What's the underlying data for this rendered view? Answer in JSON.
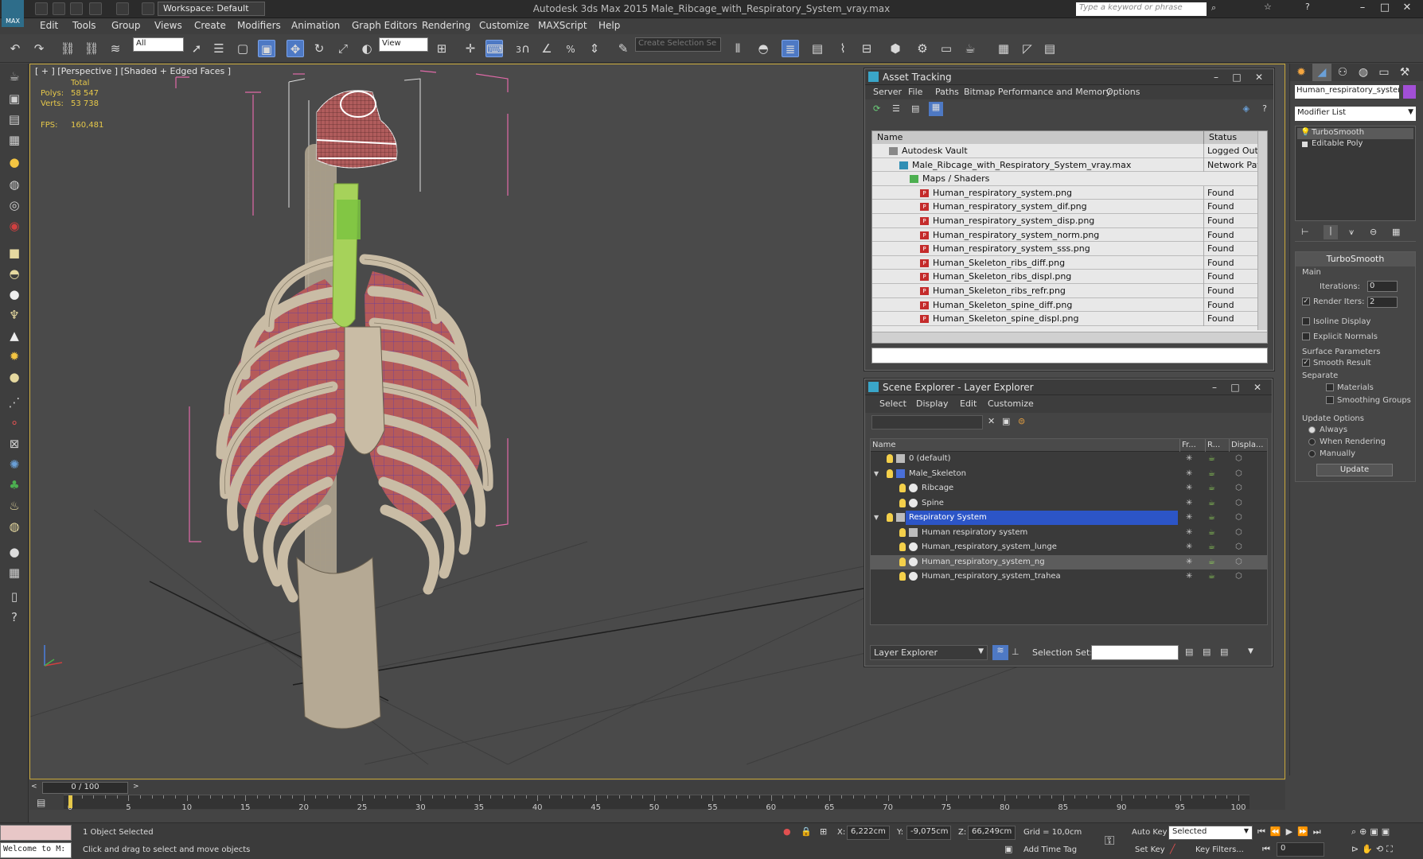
{
  "title_bar": {
    "app_title": "Autodesk 3ds Max 2015    Male_Ribcage_with_Respiratory_System_vray.max",
    "workspace": "Workspace: Default",
    "search_placeholder": "Type a keyword or phrase",
    "app_button": "MAX"
  },
  "menu": [
    "Edit",
    "Tools",
    "Group",
    "Views",
    "Create",
    "Modifiers",
    "Animation",
    "Graph Editors",
    "Rendering",
    "Customize",
    "MAXScript",
    "Help"
  ],
  "toolbar": {
    "selection_filter": "All",
    "ref_coord": "View",
    "named_selection_placeholder": "Create Selection Se",
    "snap_labels": [
      "3",
      "%"
    ]
  },
  "viewport": {
    "label": "[ + ] [Perspective ] [Shaded + Edged Faces ]",
    "stats_header": "Total",
    "polys_label": "Polys:",
    "polys_value": "58 547",
    "verts_label": "Verts:",
    "verts_value": "53 738",
    "fps_label": "FPS:",
    "fps_value": "160,481"
  },
  "asset_tracking": {
    "title": "Asset Tracking",
    "menu": [
      "Server",
      "File",
      "Paths",
      "Bitmap Performance and Memory",
      "Options"
    ],
    "columns": [
      "Name",
      "Status"
    ],
    "rows": [
      {
        "name": "Autodesk Vault",
        "status": "Logged Out ...",
        "indent": 1,
        "icon": "vault"
      },
      {
        "name": "Male_Ribcage_with_Respiratory_System_vray.max",
        "status": "Network Path",
        "indent": 2,
        "icon": "max"
      },
      {
        "name": "Maps / Shaders",
        "status": "",
        "indent": 3,
        "icon": "maps"
      },
      {
        "name": "Human_respiratory_system.png",
        "status": "Found",
        "indent": 4,
        "icon": "png"
      },
      {
        "name": "Human_respiratory_system_dif.png",
        "status": "Found",
        "indent": 4,
        "icon": "png"
      },
      {
        "name": "Human_respiratory_system_disp.png",
        "status": "Found",
        "indent": 4,
        "icon": "png"
      },
      {
        "name": "Human_respiratory_system_norm.png",
        "status": "Found",
        "indent": 4,
        "icon": "png"
      },
      {
        "name": "Human_respiratory_system_sss.png",
        "status": "Found",
        "indent": 4,
        "icon": "png"
      },
      {
        "name": "Human_Skeleton_ribs_diff.png",
        "status": "Found",
        "indent": 4,
        "icon": "png"
      },
      {
        "name": "Human_Skeleton_ribs_displ.png",
        "status": "Found",
        "indent": 4,
        "icon": "png"
      },
      {
        "name": "Human_Skeleton_ribs_refr.png",
        "status": "Found",
        "indent": 4,
        "icon": "png"
      },
      {
        "name": "Human_Skeleton_spine_diff.png",
        "status": "Found",
        "indent": 4,
        "icon": "png"
      },
      {
        "name": "Human_Skeleton_spine_displ.png",
        "status": "Found",
        "indent": 4,
        "icon": "png"
      }
    ]
  },
  "scene_explorer": {
    "title": "Scene Explorer - Layer Explorer",
    "menu": [
      "Select",
      "Display",
      "Edit",
      "Customize"
    ],
    "columns": [
      "Name",
      "Fr...",
      "R...",
      "Displa..."
    ],
    "rows": [
      {
        "name": "0 (default)",
        "level": 0,
        "type": "layer",
        "expand": ""
      },
      {
        "name": "Male_Skeleton",
        "level": 0,
        "type": "layer-blue",
        "expand": "▼"
      },
      {
        "name": "Ribcage",
        "level": 1,
        "type": "object",
        "expand": ""
      },
      {
        "name": "Spine",
        "level": 1,
        "type": "object",
        "expand": ""
      },
      {
        "name": "Respiratory System",
        "level": 0,
        "type": "layer",
        "expand": "▼",
        "selected": true
      },
      {
        "name": "Human respiratory system",
        "level": 1,
        "type": "group",
        "expand": ""
      },
      {
        "name": "Human_respiratory_system_lunge",
        "level": 1,
        "type": "object",
        "expand": ""
      },
      {
        "name": "Human_respiratory_system_ng",
        "level": 1,
        "type": "object",
        "expand": "",
        "highlight": true
      },
      {
        "name": "Human_respiratory_system_trahea",
        "level": 1,
        "type": "object",
        "expand": ""
      }
    ],
    "footer_explorer": "Layer Explorer",
    "selection_set_label": "Selection Set:"
  },
  "command_panel": {
    "object_name": "Human_respiratory_system_r",
    "object_color": "#a24fd6",
    "modifier_list": "Modifier List",
    "stack": [
      "TurboSmooth",
      "Editable Poly"
    ],
    "turbosmooth": {
      "title": "TurboSmooth",
      "main_label": "Main",
      "iterations_label": "Iterations:",
      "iterations_value": "0",
      "render_iters_label": "Render Iters:",
      "render_iters_value": "2",
      "isoline_label": "Isoline Display",
      "explicit_normals_label": "Explicit Normals",
      "surface_params_label": "Surface Parameters",
      "smooth_result_label": "Smooth Result",
      "separate_label": "Separate",
      "materials_label": "Materials",
      "smoothing_groups_label": "Smoothing Groups",
      "update_options_label": "Update Options",
      "always_label": "Always",
      "when_rendering_label": "When Rendering",
      "manually_label": "Manually",
      "update_button": "Update"
    }
  },
  "timeline": {
    "frame_counter": "0 / 100",
    "ticks": [
      "0",
      "5",
      "10",
      "15",
      "20",
      "25",
      "30",
      "35",
      "40",
      "45",
      "50",
      "55",
      "60",
      "65",
      "70",
      "75",
      "80",
      "85",
      "90",
      "95",
      "100"
    ]
  },
  "status_bar": {
    "welcome": "Welcome to M:",
    "selected_info": "1 Object Selected",
    "prompt": "Click and drag to select and move objects",
    "x_label": "X:",
    "x_value": "6,222cm",
    "y_label": "Y:",
    "y_value": "-9,075cm",
    "z_label": "Z:",
    "z_value": "66,249cm",
    "grid": "Grid = 10,0cm",
    "add_time_tag": "Add Time Tag",
    "auto_key": "Auto Key",
    "set_key": "Set Key",
    "key_mode": "Selected",
    "key_filters": "Key Filters...",
    "current_frame": "0"
  },
  "colors": {
    "selection_blue": "#2c55c7",
    "viewport_border": "#c9a83a",
    "stat_yellow": "#e6c84a",
    "bbox_pink": "#e06aa8"
  }
}
